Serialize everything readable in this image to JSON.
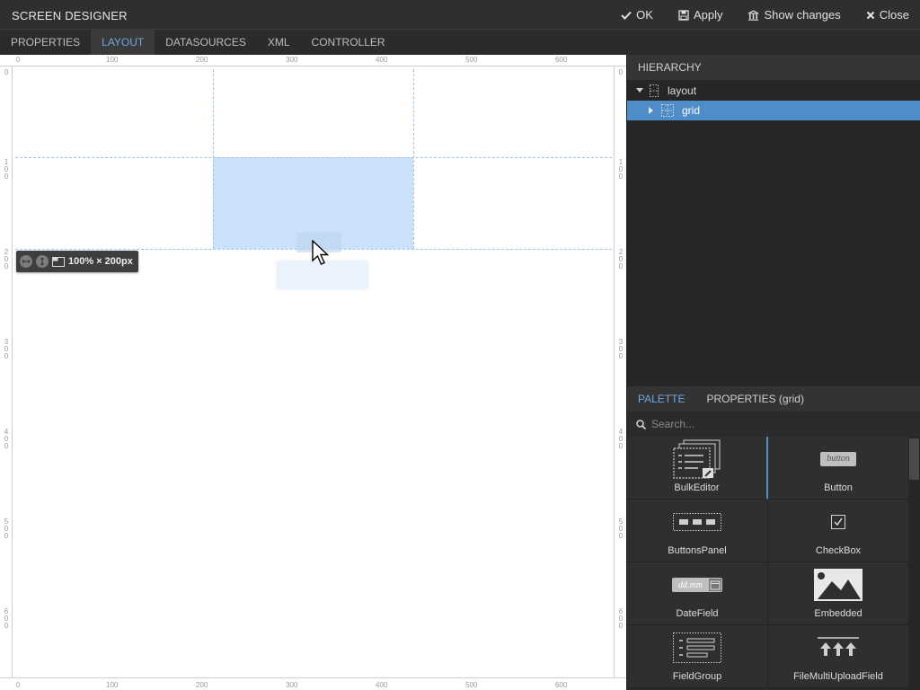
{
  "app": {
    "title": "SCREEN DESIGNER"
  },
  "actions": {
    "ok": "OK",
    "apply": "Apply",
    "show_changes": "Show changes",
    "close": "Close"
  },
  "tabs": [
    {
      "label": "PROPERTIES"
    },
    {
      "label": "LAYOUT"
    },
    {
      "label": "DATASOURCES"
    },
    {
      "label": "XML"
    },
    {
      "label": "CONTROLLER"
    }
  ],
  "active_tab": "LAYOUT",
  "ruler": {
    "top": [
      "0",
      "100",
      "200",
      "300",
      "400",
      "500",
      "600"
    ],
    "side": [
      "0",
      "100",
      "200",
      "300",
      "400",
      "500",
      "600"
    ]
  },
  "canvas": {
    "size_badge": "100% × 200px"
  },
  "hierarchy": {
    "title": "HIERARCHY",
    "items": [
      {
        "label": "layout"
      },
      {
        "label": "grid"
      }
    ]
  },
  "palette": {
    "tab_palette": "PALETTE",
    "tab_properties": "PROPERTIES (grid)",
    "search_placeholder": "Search...",
    "items": [
      {
        "label": "BulkEditor",
        "icon": "bulk-editor-icon"
      },
      {
        "label": "Button",
        "icon": "button-icon",
        "icon_text": "button"
      },
      {
        "label": "ButtonsPanel",
        "icon": "buttons-panel-icon"
      },
      {
        "label": "CheckBox",
        "icon": "checkbox-icon"
      },
      {
        "label": "DateField",
        "icon": "date-field-icon",
        "icon_text": "dd.mm"
      },
      {
        "label": "Embedded",
        "icon": "image-icon"
      },
      {
        "label": "FieldGroup",
        "icon": "field-group-icon"
      },
      {
        "label": "FileMultiUploadField",
        "icon": "multi-upload-icon"
      }
    ]
  },
  "colors": {
    "accent": "#6ea8e0",
    "selection": "#4f8dc9",
    "grid_line": "#9fc4e8",
    "cell_highlight": "#cbe1fa"
  }
}
